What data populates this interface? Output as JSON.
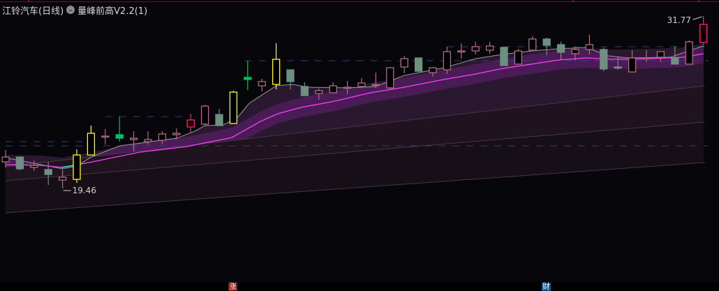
{
  "header": {
    "stock_title": "江铃汽车(日线)",
    "indicator_icon": "chevron-down-circle-icon",
    "indicator_name": "量峰前高V2.2(1)"
  },
  "bottom_badges": [
    {
      "label": "涨",
      "color": "#8b0c0c"
    },
    {
      "label": "财",
      "color": "#0f4a80"
    }
  ],
  "colors": {
    "up": "#b06a86",
    "down": "#6e9080",
    "yellow": "#ffff00",
    "green": "#00c060",
    "hot": "#ff1f7a",
    "ma_gray": "#9a9a9a",
    "ma_pink": "#ff3cff",
    "band": "#4a1c55",
    "upper_fill": "#2a1830"
  },
  "chart_data": {
    "type": "candlestick",
    "title": "江铃汽车(日线)",
    "ylim": [
      17.0,
      31.77
    ],
    "high_label": "31.77",
    "low_label": "19.46",
    "high_index": 49,
    "low_index": 4,
    "candles": [
      [
        21.36,
        21.7,
        22.2,
        20.96,
        "up"
      ],
      [
        21.7,
        20.86,
        21.75,
        20.76,
        "down"
      ],
      [
        20.96,
        21.11,
        21.46,
        20.71,
        "up"
      ],
      [
        20.81,
        20.46,
        21.36,
        19.71,
        "down"
      ],
      [
        20.06,
        20.26,
        20.81,
        19.46,
        "up"
      ],
      [
        20.11,
        21.85,
        22.25,
        19.86,
        "yellow"
      ],
      [
        21.85,
        23.4,
        23.95,
        21.85,
        "yellow"
      ],
      [
        23.15,
        23.2,
        23.7,
        22.6,
        "up"
      ],
      [
        23.3,
        23.05,
        24.59,
        22.8,
        "green"
      ],
      [
        22.95,
        23.05,
        23.55,
        22.1,
        "up"
      ],
      [
        22.8,
        22.95,
        23.55,
        22.6,
        "up"
      ],
      [
        22.9,
        23.35,
        23.55,
        22.65,
        "up"
      ],
      [
        23.3,
        23.4,
        23.75,
        22.95,
        "up"
      ],
      [
        23.85,
        24.35,
        24.79,
        23.45,
        "hot"
      ],
      [
        24.05,
        25.34,
        25.44,
        23.95,
        "up"
      ],
      [
        24.74,
        23.95,
        25.14,
        23.95,
        "down"
      ],
      [
        24.1,
        26.34,
        26.44,
        24.1,
        "yellow"
      ],
      [
        27.39,
        27.24,
        28.58,
        26.49,
        "green"
      ],
      [
        26.79,
        27.09,
        27.29,
        26.39,
        "up"
      ],
      [
        26.89,
        28.68,
        29.83,
        26.54,
        "yellow"
      ],
      [
        27.93,
        27.09,
        27.93,
        26.54,
        "down"
      ],
      [
        26.74,
        26.09,
        27.04,
        26.04,
        "down"
      ],
      [
        26.24,
        26.44,
        26.59,
        25.79,
        "up"
      ],
      [
        26.29,
        26.79,
        27.04,
        26.24,
        "up"
      ],
      [
        26.64,
        26.69,
        27.14,
        26.19,
        "up"
      ],
      [
        26.74,
        26.99,
        27.34,
        26.64,
        "up"
      ],
      [
        26.84,
        26.89,
        27.73,
        26.64,
        "up"
      ],
      [
        26.64,
        28.08,
        28.08,
        26.54,
        "up"
      ],
      [
        28.13,
        28.73,
        28.93,
        27.69,
        "up"
      ],
      [
        28.78,
        27.83,
        28.78,
        27.78,
        "down"
      ],
      [
        27.73,
        28.08,
        28.13,
        27.44,
        "up"
      ],
      [
        27.93,
        29.23,
        29.58,
        27.64,
        "up"
      ],
      [
        29.23,
        29.28,
        29.83,
        28.73,
        "up"
      ],
      [
        29.28,
        29.58,
        29.93,
        29.03,
        "up"
      ],
      [
        29.33,
        29.63,
        29.93,
        29.08,
        "up"
      ],
      [
        29.53,
        28.24,
        29.58,
        28.24,
        "down"
      ],
      [
        28.34,
        29.28,
        29.43,
        28.34,
        "up"
      ],
      [
        29.33,
        30.13,
        30.33,
        29.28,
        "up"
      ],
      [
        30.13,
        29.68,
        30.23,
        28.98,
        "down"
      ],
      [
        29.73,
        29.18,
        29.93,
        28.68,
        "down"
      ],
      [
        29.08,
        29.38,
        29.58,
        28.58,
        "up"
      ],
      [
        29.38,
        29.73,
        30.43,
        29.03,
        "up"
      ],
      [
        29.38,
        27.99,
        29.53,
        27.83,
        "down"
      ],
      [
        28.13,
        28.13,
        28.83,
        27.93,
        "down"
      ],
      [
        27.78,
        28.78,
        29.33,
        27.78,
        "up"
      ],
      [
        28.78,
        28.78,
        29.33,
        28.49,
        "up"
      ],
      [
        28.83,
        29.23,
        29.23,
        28.49,
        "up"
      ],
      [
        28.78,
        28.34,
        29.63,
        28.34,
        "down"
      ],
      [
        28.34,
        29.93,
        30.03,
        28.34,
        "up"
      ],
      [
        29.88,
        31.17,
        31.77,
        29.68,
        "hot"
      ]
    ],
    "gray_line": [
      [
        0,
        21.65
      ],
      [
        4,
        20.86
      ],
      [
        5,
        21.06
      ],
      [
        6,
        21.7
      ],
      [
        8,
        22.5
      ],
      [
        12,
        23.05
      ],
      [
        13.3,
        23.55
      ],
      [
        14,
        23.95
      ],
      [
        15.3,
        24.0
      ],
      [
        16.3,
        24.54
      ],
      [
        17.1,
        25.54
      ],
      [
        19,
        26.79
      ],
      [
        20.2,
        26.89
      ],
      [
        21.2,
        26.69
      ],
      [
        24,
        26.64
      ],
      [
        26,
        26.74
      ],
      [
        28,
        27.53
      ],
      [
        30.8,
        28.08
      ],
      [
        33,
        28.73
      ],
      [
        34.9,
        29.03
      ],
      [
        36.9,
        29.28
      ],
      [
        38.8,
        29.43
      ],
      [
        40.8,
        29.53
      ],
      [
        42.3,
        28.93
      ],
      [
        43.7,
        28.78
      ],
      [
        46.7,
        28.83
      ],
      [
        48.1,
        29.33
      ],
      [
        49,
        29.63
      ]
    ],
    "pink_line": [
      [
        0,
        21.16
      ],
      [
        2.5,
        21.11
      ],
      [
        4,
        20.96
      ],
      [
        6.1,
        21.36
      ],
      [
        9.4,
        22.05
      ],
      [
        12.7,
        22.45
      ],
      [
        15.9,
        23.1
      ],
      [
        17.9,
        24.25
      ],
      [
        19.1,
        24.79
      ],
      [
        20.7,
        25.24
      ],
      [
        23.1,
        25.69
      ],
      [
        25.6,
        26.29
      ],
      [
        28,
        26.69
      ],
      [
        30.5,
        27.19
      ],
      [
        33,
        27.63
      ],
      [
        34.9,
        28.03
      ],
      [
        36.9,
        28.33
      ],
      [
        38.8,
        28.63
      ],
      [
        40.8,
        28.78
      ],
      [
        42.7,
        28.68
      ],
      [
        45.2,
        28.73
      ],
      [
        47.6,
        28.83
      ],
      [
        49,
        29.08
      ]
    ],
    "support_lines": [
      [
        21.01,
        26.79
      ],
      [
        20.01,
        24.2
      ],
      [
        17.72,
        21.31
      ]
    ],
    "dashed_levels": [
      {
        "price": 22.8,
        "from": 0,
        "to": 5.5
      },
      {
        "price": 22.5,
        "from": 0,
        "to": 49.5
      },
      {
        "price": 24.59,
        "from": 7,
        "to": 12.5
      },
      {
        "price": 28.58,
        "from": 16.8,
        "to": 49.5
      },
      {
        "price": 29.58,
        "from": 31,
        "to": 49.5
      }
    ]
  }
}
